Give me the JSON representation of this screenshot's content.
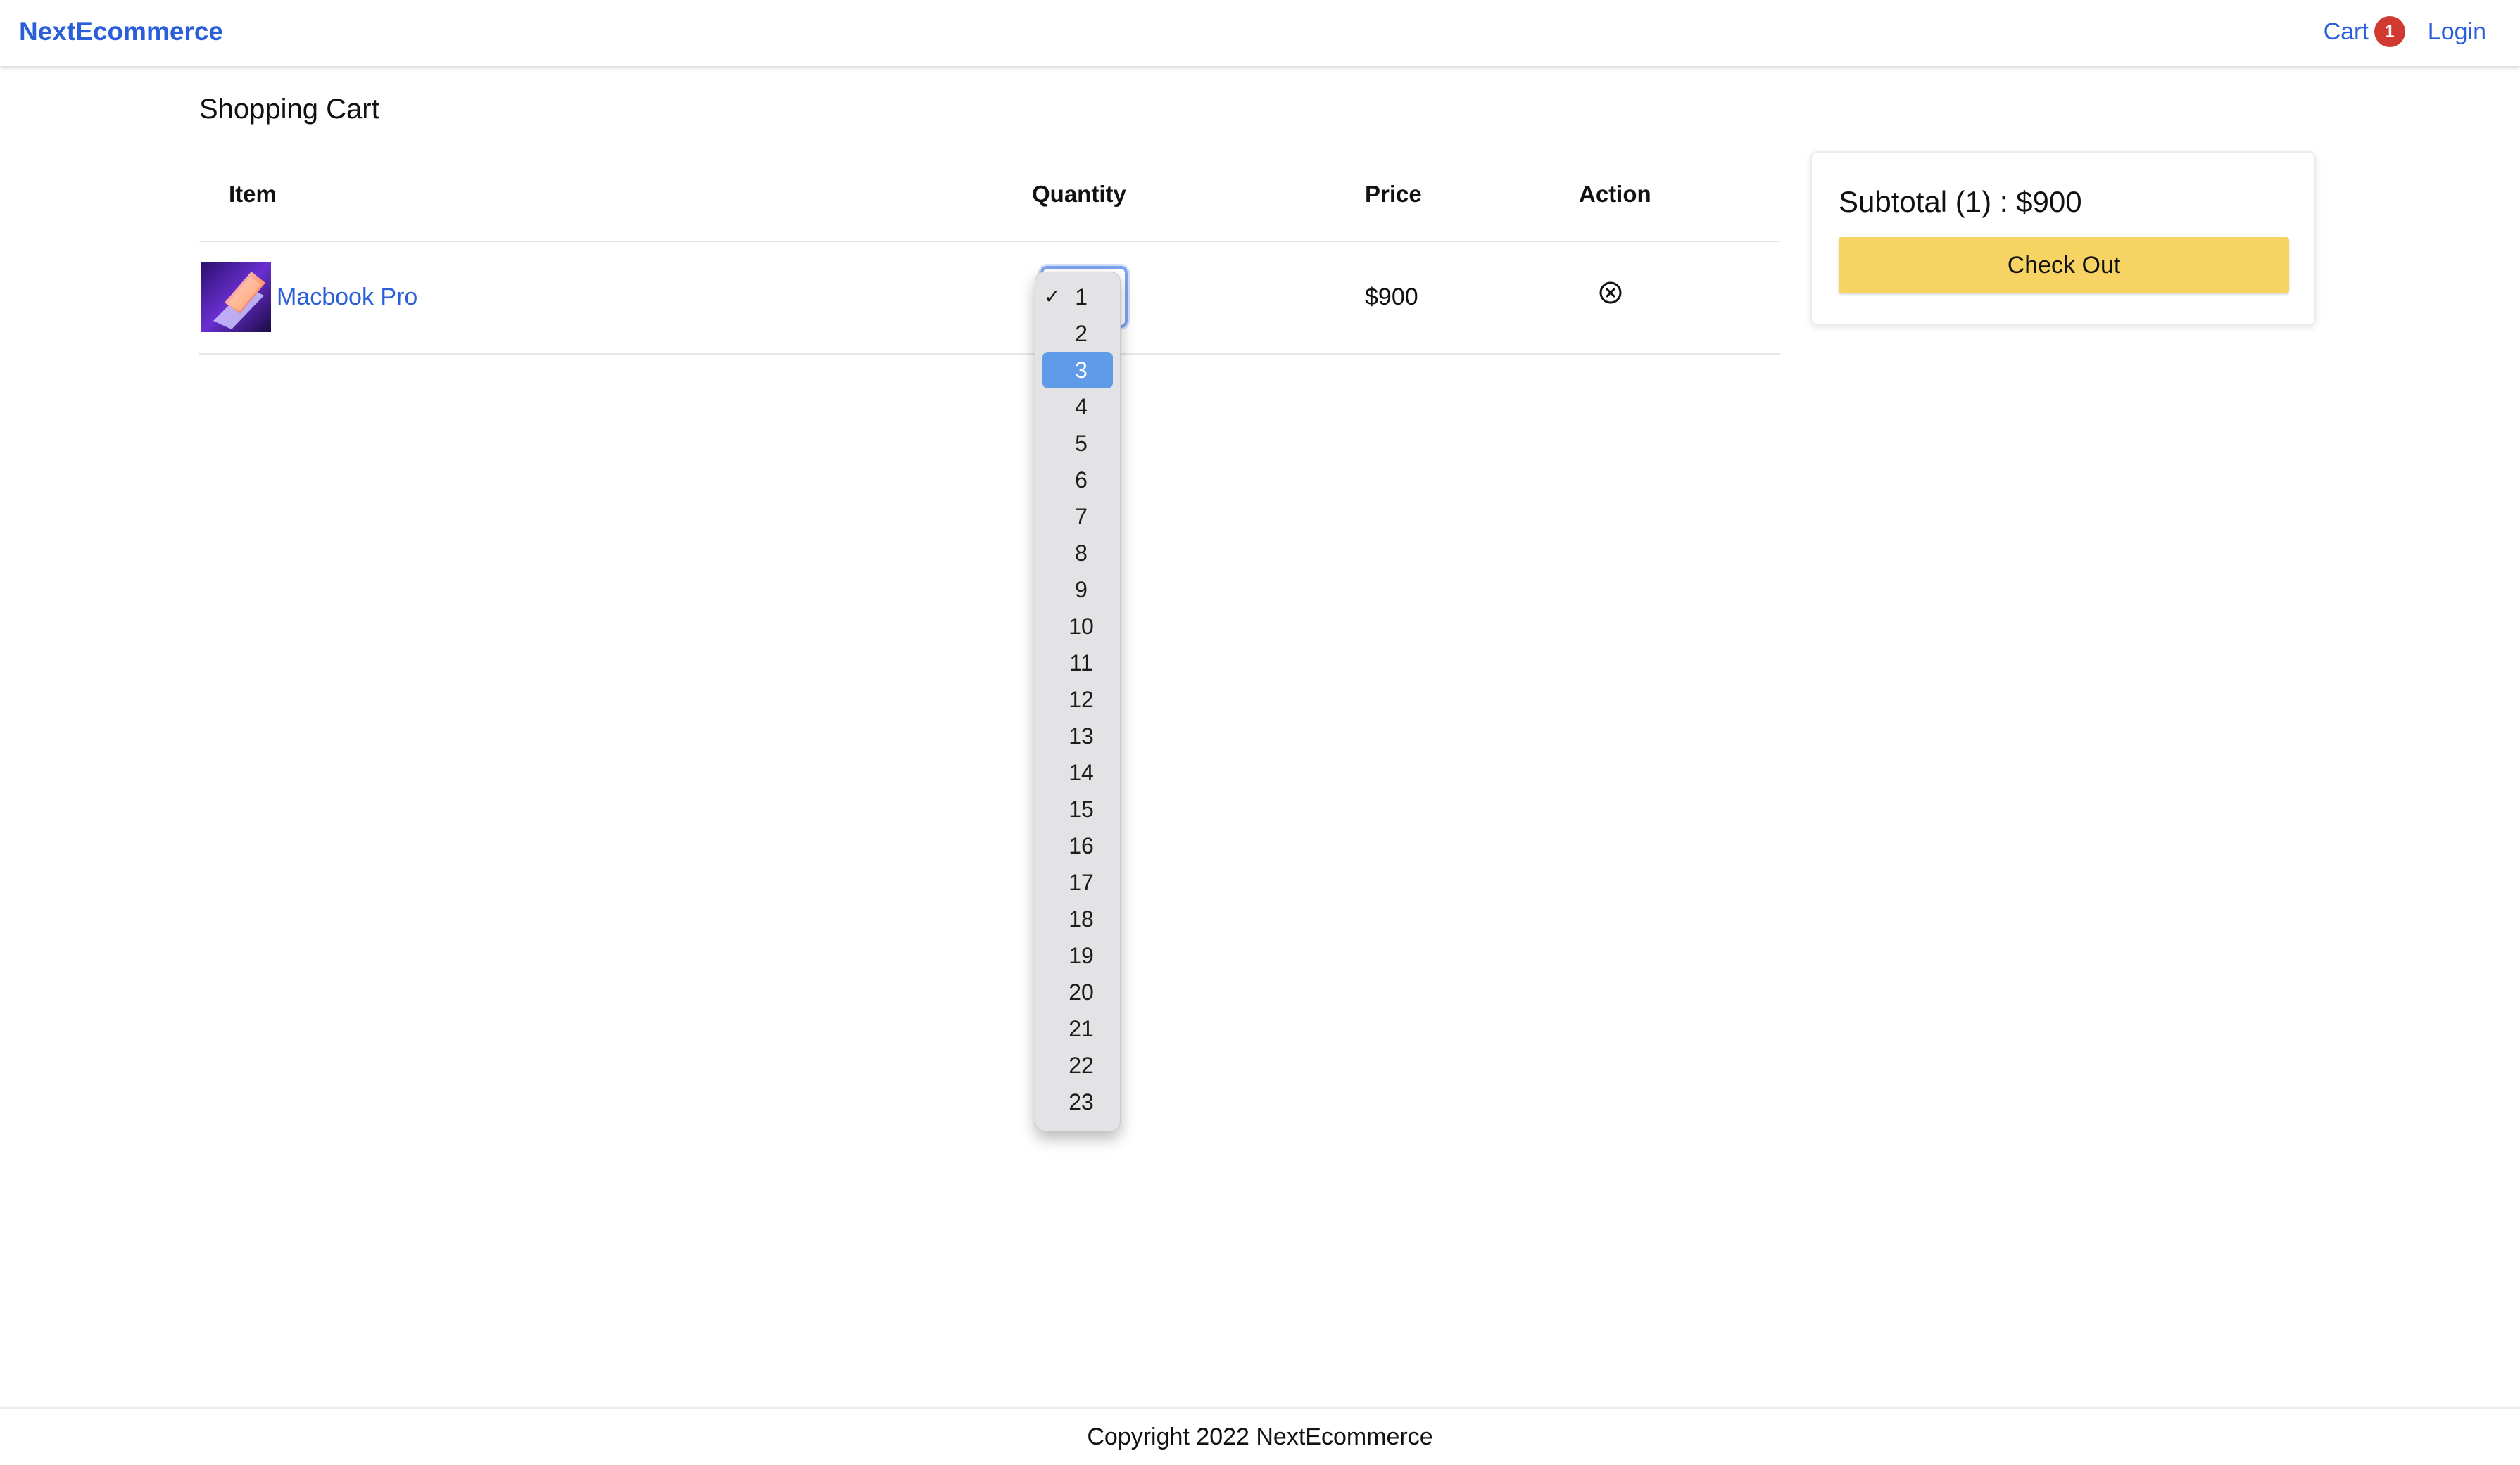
{
  "navbar": {
    "brand": "NextEcommerce",
    "cart_label": "Cart",
    "cart_count": "1",
    "login_label": "Login"
  },
  "page": {
    "title": "Shopping Cart"
  },
  "table": {
    "headers": {
      "item": "Item",
      "quantity": "Quantity",
      "price": "Price",
      "action": "Action"
    },
    "rows": [
      {
        "name": "Macbook Pro",
        "quantity": "1",
        "price": "$900",
        "remove_icon": "circle-x-icon"
      }
    ]
  },
  "quantity_dropdown": {
    "selected": "1",
    "highlighted": "3",
    "options": [
      "1",
      "2",
      "3",
      "4",
      "5",
      "6",
      "7",
      "8",
      "9",
      "10",
      "11",
      "12",
      "13",
      "14",
      "15",
      "16",
      "17",
      "18",
      "19",
      "20",
      "21",
      "22",
      "23"
    ]
  },
  "summary": {
    "subtotal": "Subtotal (1) : $900",
    "checkout_label": "Check Out"
  },
  "footer": {
    "text": "Copyright 2022 NextEcommerce"
  },
  "colors": {
    "link": "#2b5fd9",
    "badge": "#d13a30",
    "checkout": "#f6d363",
    "dropdown_highlight": "#5f9be8"
  }
}
